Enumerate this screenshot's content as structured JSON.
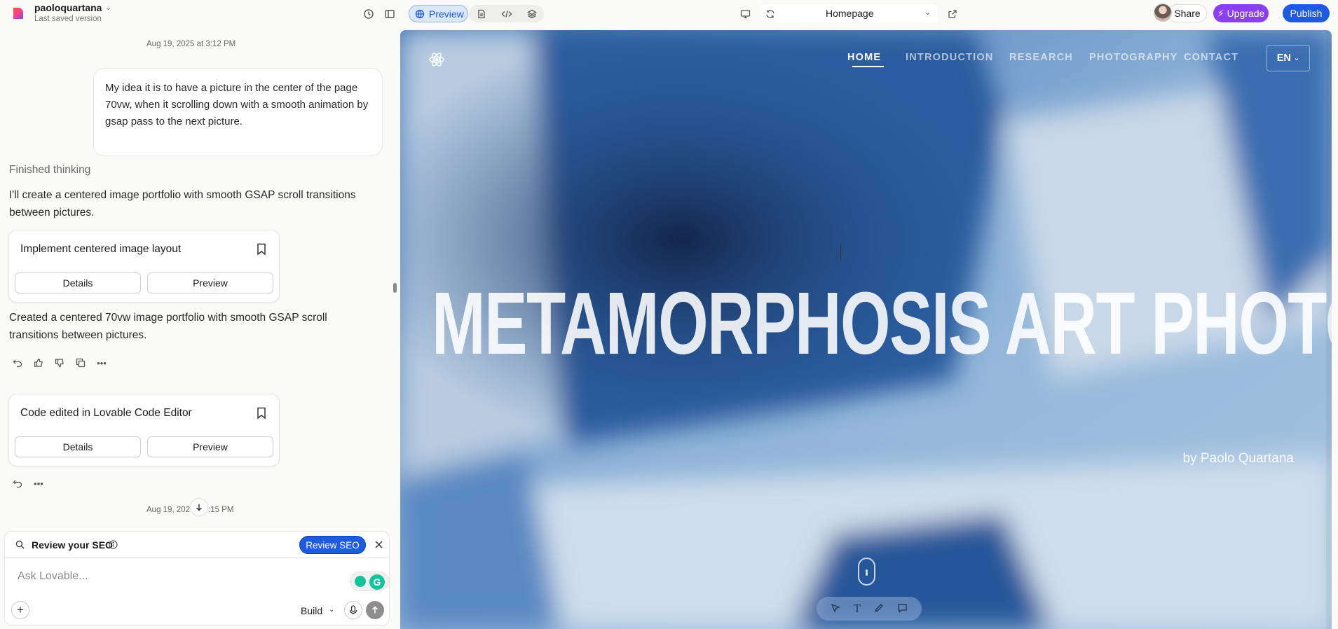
{
  "topbar": {
    "project_name": "paoloquartana",
    "saved_status": "Last saved version",
    "preview_label": "Preview",
    "route": "Homepage",
    "share_label": "Share",
    "upgrade_label": "Upgrade",
    "publish_label": "Publish"
  },
  "chat": {
    "timestamp_1": "Aug 19, 2025 at 3:12 PM",
    "user_message": "My idea it is to have a picture in the center of the page 70vw, when it scrolling down with a smooth animation by gsap pass to the next picture.",
    "thinking_label": "Finished thinking",
    "reply_1": "I'll create a centered image portfolio with smooth GSAP scroll transitions between pictures.",
    "card_1": {
      "title": "Implement centered image layout",
      "details": "Details",
      "preview": "Preview"
    },
    "reply_2": "Created a centered 70vw image portfolio with smooth GSAP scroll transitions between pictures.",
    "card_2": {
      "title": "Code edited in Lovable Code Editor",
      "details": "Details",
      "preview": "Preview"
    },
    "timestamp_2_left": "Aug 19, 202",
    "timestamp_2_right": ":15 PM"
  },
  "seo": {
    "label": "Review your SEO",
    "button": "Review SEO"
  },
  "composer": {
    "placeholder": "Ask Lovable...",
    "mode": "Build"
  },
  "site": {
    "nav": [
      "HOME",
      "INTRODUCTION",
      "RESEARCH",
      "PHOTOGRAPHY",
      "CONTACT"
    ],
    "language": "EN",
    "hero_title": "METAMORPHOSIS ART PHOTO",
    "hero_byline": "by Paolo Quartana"
  },
  "colors": {
    "accent_blue": "#1f5be0",
    "upgrade_purple": "#8a3ff0"
  }
}
